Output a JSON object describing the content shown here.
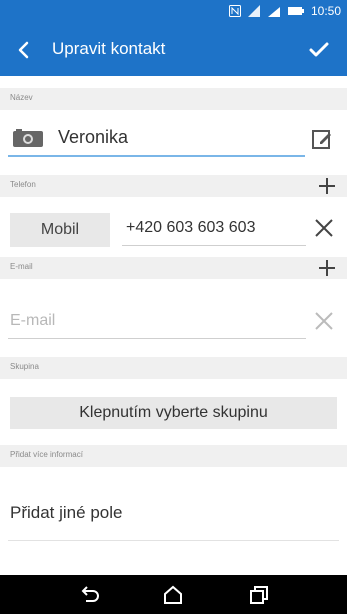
{
  "status_bar": {
    "time": "10:50"
  },
  "header": {
    "title": "Upravit kontakt"
  },
  "sections": {
    "name": "Název",
    "phone": "Telefon",
    "email": "E-mail",
    "group": "Skupina",
    "more": "Přidat více informací"
  },
  "contact": {
    "name": "Veronika",
    "phone_type": "Mobil",
    "phone_number": "+420 603 603 603",
    "email_placeholder": "E-mail"
  },
  "group_button": "Klepnutím vyberte skupinu",
  "add_field": "Přidat jiné pole",
  "icons": [
    "back-icon",
    "checkmark-icon",
    "camera-icon",
    "edit-icon",
    "plus-icon",
    "close-icon",
    "nav-back-icon",
    "nav-home-icon",
    "nav-recent-icon"
  ],
  "colors": {
    "accent": "#1e73c8",
    "underline_focus": "#7ab6e8"
  }
}
